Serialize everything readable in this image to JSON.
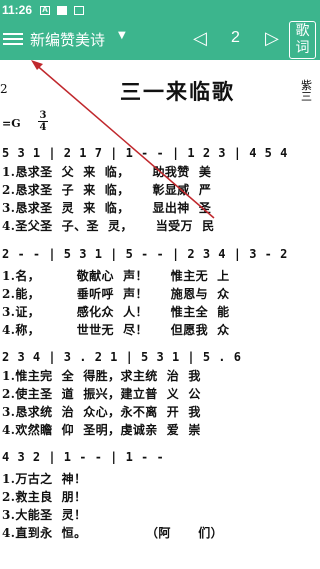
{
  "status_bar": {
    "time": "11:26",
    "icon1": "A",
    "icon2": "",
    "icon3": ""
  },
  "toolbar": {
    "collection_title": "新编赞美诗",
    "page_number": "2",
    "lyrics_button_label": "歌词"
  },
  "sheet": {
    "title": "三一来临歌",
    "left_mark": "2",
    "right_mark": "紫\n三",
    "key_signature": "=G",
    "time_signature": {
      "top": "3",
      "bottom": "4"
    },
    "systems": [
      {
        "notes": "5 3 1 | 2 1 7 | 1 - - | 1 2 3 | 4 5 4",
        "lyrics": [
          "1.恳求圣  父  来  临，     助我赞  美",
          "2.恳求圣  子  来  临，     彰显威  严",
          "3.恳求圣  灵  来  临，     显出神  圣",
          "4.圣父圣  子、圣  灵，     当受万  民"
        ]
      },
      {
        "notes": "2 - - | 5 3 1 | 5 - - | 2 3 4 | 3 - 2",
        "lyrics": [
          "1.名，        敬献心  声！     惟主无  上",
          "2.能，        垂听呼  声！     施恩与  众",
          "3.证，        感化众  人！     惟主全  能",
          "4.称，        世世无  尽！     但愿我  众"
        ]
      },
      {
        "notes": "2 3 4 | 3 . 2 1 | 5 3 1 | 5 . 6",
        "lyrics": [
          "1.惟主完  全  得胜，求主统  治  我",
          "2.使主圣  道  振兴，建立普  义  公",
          "3.恳求统  治  众心，永不离  开  我",
          "4.欢然瞻  仰  圣明，虔诚亲  爱  崇"
        ]
      },
      {
        "notes": "4 3 2 | 1 - - | 1 - -",
        "lyrics": [
          "1.万古之  神！",
          "2.救主良  朋！",
          "3.大能圣  灵！",
          "4.直到永  恒。             （阿      们）"
        ]
      }
    ]
  }
}
